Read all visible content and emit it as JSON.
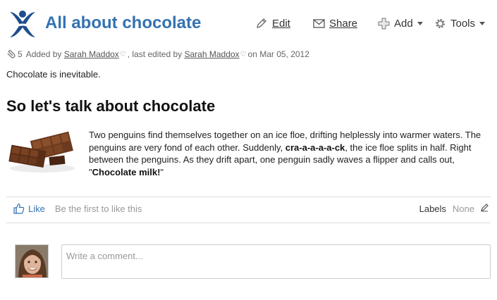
{
  "page": {
    "title": "All about chocolate"
  },
  "toolbar": {
    "edit_label": "Edit",
    "share_label": "Share",
    "add_label": "Add",
    "tools_label": "Tools"
  },
  "meta": {
    "attachment_count": "5",
    "added_by_prefix": "Added by",
    "added_by_user": "Sarah Maddox",
    "edited_by_prefix": ", last edited by",
    "edited_by_user": "Sarah Maddox",
    "date_text": "on Mar 05, 2012"
  },
  "content": {
    "intro": "Chocolate is inevitable.",
    "heading": "So let's talk about chocolate",
    "story": {
      "part1": "Two penguins find themselves together on an ice floe, drifting helplessly into warmer waters. The penguins are very fond of each other. Suddenly, ",
      "bold1": "cra-a-a-a-a-ck",
      "part2": ", the ice floe splits in half. Right between the penguins. As they drift apart, one penguin sadly waves a flipper and calls out, \"",
      "bold2": "Chocolate milk!",
      "part3": "\""
    }
  },
  "likes": {
    "like_label": "Like",
    "hint": "Be the first to like this"
  },
  "labels": {
    "title": "Labels",
    "value": "None"
  },
  "comment": {
    "placeholder": "Write a comment..."
  },
  "colors": {
    "accent": "#3572b0",
    "logo_blue": "#1f4e8c"
  },
  "icons": {
    "logo": "confluence-x-logo",
    "edit": "pencil-icon",
    "share": "envelope-icon",
    "add": "plus-icon",
    "tools": "gear-icon",
    "attachment": "paperclip-icon",
    "like": "thumbs-up-icon",
    "labels_edit": "pencil-icon"
  }
}
